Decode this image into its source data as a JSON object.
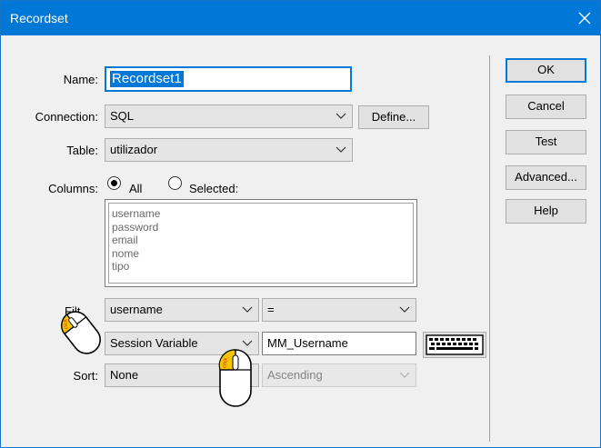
{
  "window": {
    "title": "Recordset"
  },
  "form": {
    "name": {
      "label": "Name:",
      "value": "Recordset1"
    },
    "connection": {
      "label": "Connection:",
      "value": "SQL",
      "define_label": "Define..."
    },
    "table": {
      "label": "Table:",
      "value": "utilizador"
    },
    "columns": {
      "label": "Columns:",
      "all_label": "All",
      "selected_label": "Selected:",
      "selected_option": "All",
      "items": [
        "username",
        "password",
        "email",
        "nome",
        "tipo"
      ]
    },
    "filter": {
      "label": "Filt",
      "column": "username",
      "operator": "=",
      "source": "Session Variable",
      "value": "MM_Username"
    },
    "sort": {
      "label": "Sort:",
      "column": "None",
      "order": "Ascending"
    }
  },
  "buttons": {
    "ok": "OK",
    "cancel": "Cancel",
    "test": "Test",
    "advanced": "Advanced...",
    "help": "Help"
  },
  "annotations": {
    "click_text": "click"
  },
  "colors": {
    "titlebar": "#0078d7",
    "selection": "#0078d7",
    "mouse_highlight": "#f5c400"
  }
}
